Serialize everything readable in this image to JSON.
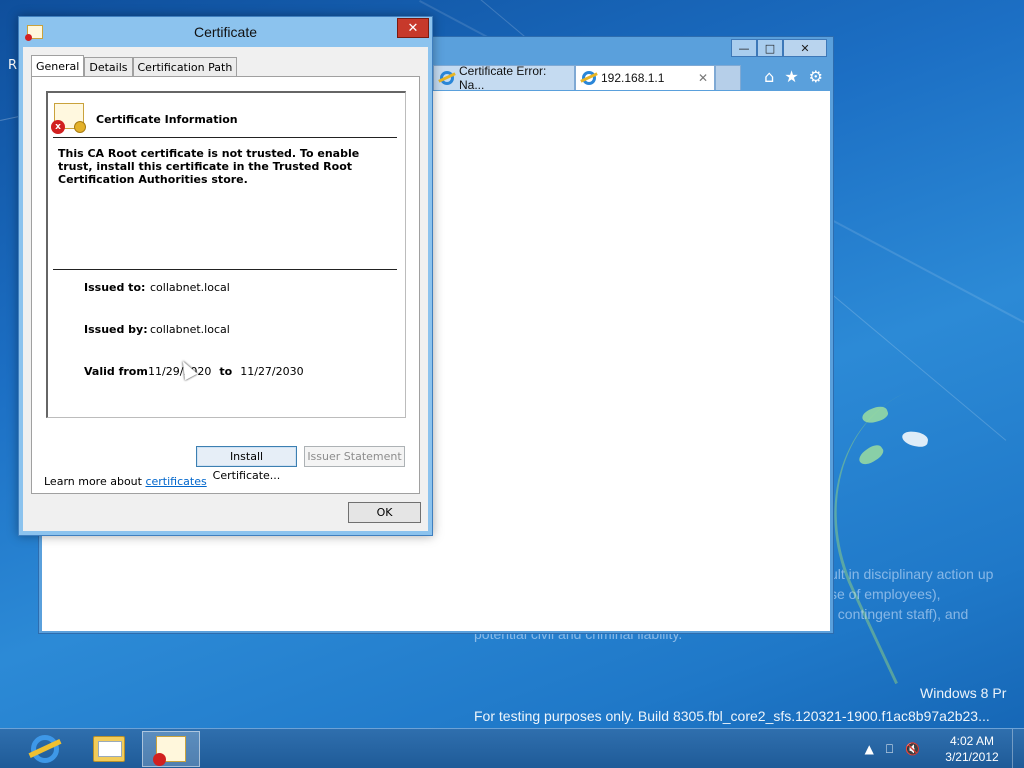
{
  "desktop": {
    "partial_icon_label": "R",
    "watermark": {
      "line1": "Windows 8 Pr",
      "line2": "For testing purposes only. Build 8305.fbl_core2_sfs.120321-1900.f1ac8b97a2b23..."
    },
    "background_text": {
      "line1": "ult in disciplinary action up",
      "line2": "se of employees),",
      "line3": "f contingent staff), and",
      "line4": "potential civil and criminal liability."
    }
  },
  "browser": {
    "caption_buttons": {
      "minimize": "—",
      "maximize": "□",
      "close": "✕"
    },
    "tabs": [
      {
        "label": "Certificate Error: Na...",
        "icon": "ie-icon"
      },
      {
        "label": "192.168.1.1",
        "icon": "ie-icon",
        "close": "✕"
      }
    ],
    "toolbar": {
      "home": "⌂",
      "favorites": "★",
      "tools": "⚙"
    }
  },
  "dialog": {
    "title": "Certificate",
    "close_glyph": "✕",
    "tabs": [
      "General",
      "Details",
      "Certification Path"
    ],
    "info_title": "Certificate Information",
    "message": "This CA Root certificate is not trusted. To enable trust, install this certificate in the Trusted Root Certification Authorities store.",
    "issued_to_label": "Issued to:",
    "issued_to_value": "collabnet.local",
    "issued_by_label": "Issued by:",
    "issued_by_value": "collabnet.local",
    "valid_from_label": "Valid from",
    "valid_from_value": "11/29/2020",
    "valid_to_label": "to",
    "valid_to_value": "11/27/2030",
    "install_button": "Install Certificate...",
    "issuer_button": "Issuer Statement",
    "learn_prefix": "Learn more about ",
    "learn_link": "certificates",
    "ok_button": "OK"
  },
  "taskbar": {
    "apps": [
      "internet-explorer",
      "file-explorer",
      "certificate"
    ],
    "time": "4:02 AM",
    "date": "3/21/2012",
    "tray_icons": {
      "chevron": "▲",
      "network": "⎕",
      "volume": "🔇"
    }
  },
  "colors": {
    "desktop_blue": "#1c6fc4",
    "window_frame": "#8cc3ee",
    "close_red": "#c7392b",
    "link_blue": "#0066cc"
  }
}
